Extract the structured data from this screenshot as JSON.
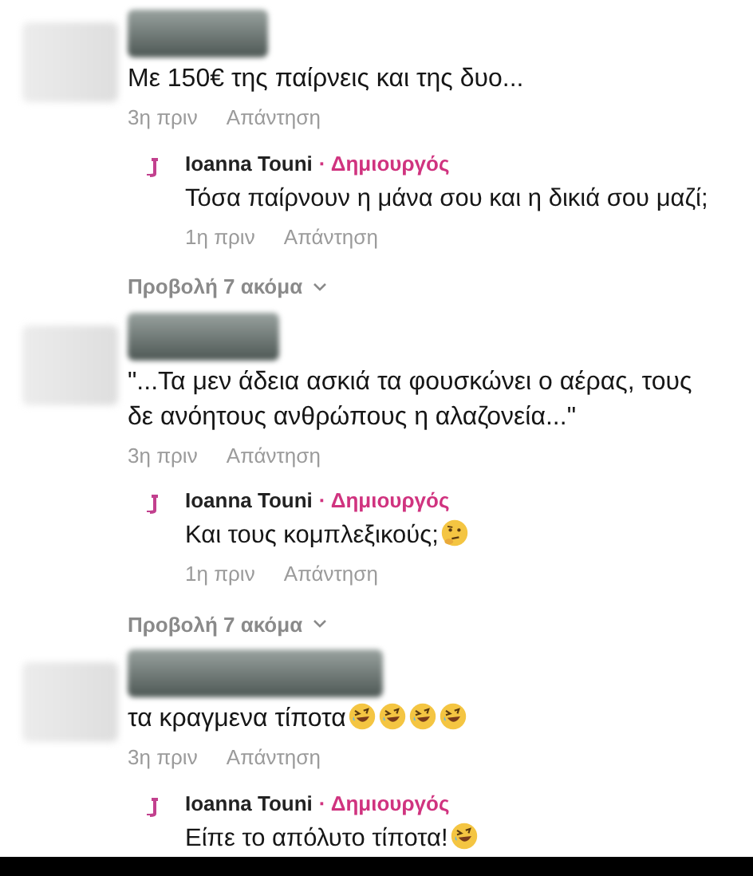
{
  "threads": [
    {
      "comment": {
        "text": "Με 150€ της παίρνεις και της δυο...",
        "time": "3η πριν",
        "reply_label": "Απάντηση"
      },
      "reply": {
        "author": "Ioanna Touni",
        "badge": "· Δημιουργός",
        "text": "Τόσα παίρνουν η μάνα σου και η δικιά σου μαζί;",
        "time": "1η πριν",
        "reply_label": "Απάντηση"
      },
      "more": "Προβολή 7 ακόμα"
    },
    {
      "comment": {
        "text": "\"...Τα μεν άδεια ασκιά τα φουσκώνει ο αέρας, τους δε ανόητους ανθρώπους η αλαζονεία...\"",
        "time": "3η πριν",
        "reply_label": "Απάντηση"
      },
      "reply": {
        "author": "Ioanna Touni",
        "badge": "· Δημιουργός",
        "text": "Και τους κομπλεξικούς;",
        "emojis": [
          {
            "kind": "thinking"
          }
        ],
        "time": "1η πριν",
        "reply_label": "Απάντηση"
      },
      "more": "Προβολή 7 ακόμα"
    },
    {
      "comment": {
        "text": "τα κραγμενα τίποτα",
        "emojis": [
          {
            "kind": "laughing"
          },
          {
            "kind": "laughing"
          },
          {
            "kind": "laughing"
          },
          {
            "kind": "laughing"
          }
        ],
        "time": "3η πριν",
        "reply_label": "Απάντηση"
      },
      "reply": {
        "author": "Ioanna Touni",
        "badge": "· Δημιουργός",
        "text": "Είπε το απόλυτο τίποτα!",
        "emojis": [
          {
            "kind": "laughing"
          }
        ]
      }
    }
  ]
}
